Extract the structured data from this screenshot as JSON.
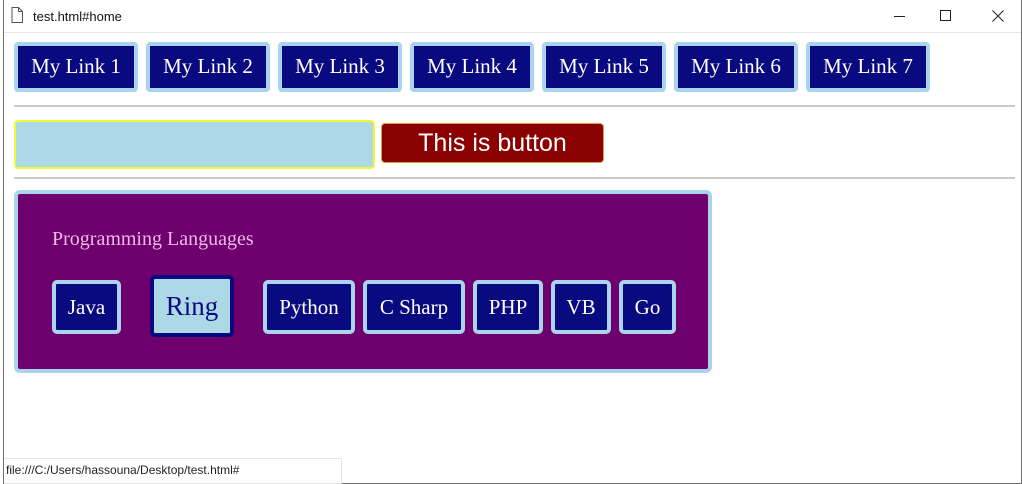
{
  "window": {
    "title": "test.html#home",
    "controls": [
      "minimize-icon",
      "maximize-icon",
      "close-icon"
    ]
  },
  "nav": {
    "links": [
      "My Link 1",
      "My Link 2",
      "My Link 3",
      "My Link 4",
      "My Link 5",
      "My Link 6",
      "My Link 7"
    ]
  },
  "form": {
    "input_value": "",
    "button_label": "This is button"
  },
  "languages": {
    "title": "Programming Languages",
    "items": [
      "Java",
      "Ring",
      "Python",
      "C Sharp",
      "PHP",
      "VB",
      "Go"
    ],
    "selected": "Ring"
  },
  "status_bar": {
    "url": "file:///C:/Users/hassouna/Desktop/test.html#"
  },
  "colors": {
    "nav_button_bg": "#0a0a80",
    "button_border": "#a9d4ec",
    "input_bg": "#add8e6",
    "input_border": "#f5f538",
    "red_button_bg": "#8b0000",
    "panel_bg": "#6d006d",
    "panel_title": "#f0b8e8"
  }
}
